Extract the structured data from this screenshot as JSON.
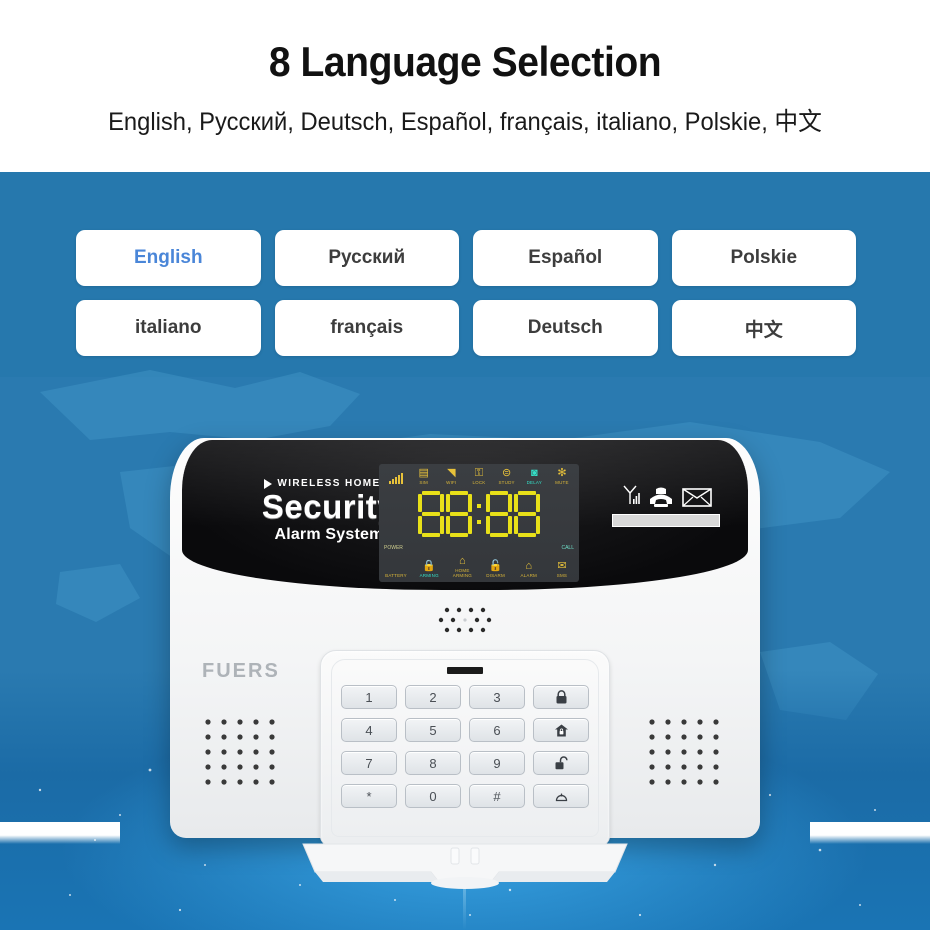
{
  "header": {
    "title": "8 Language Selection",
    "subtitle": "English, Русский, Deutsch, Español, français, italiano, Polskie, 中文"
  },
  "language_buttons": [
    {
      "label": "English",
      "name": "lang-button-english",
      "selected": true
    },
    {
      "label": "Русский",
      "name": "lang-button-russian",
      "selected": false
    },
    {
      "label": "Español",
      "name": "lang-button-spanish",
      "selected": false
    },
    {
      "label": "Polskie",
      "name": "lang-button-polish",
      "selected": false
    },
    {
      "label": "italiano",
      "name": "lang-button-italian",
      "selected": false
    },
    {
      "label": "français",
      "name": "lang-button-french",
      "selected": false
    },
    {
      "label": "Deutsch",
      "name": "lang-button-german",
      "selected": false
    },
    {
      "label": "中文",
      "name": "lang-button-chinese",
      "selected": false
    }
  ],
  "device": {
    "brand_top": "WIRELESS HOME",
    "brand_main": "Security",
    "brand_sub": "Alarm System",
    "logo": "FUERS",
    "lcd": {
      "display_value": "88:88",
      "top_icons": [
        {
          "label": "",
          "icon": "signal-bars-icon",
          "active": false
        },
        {
          "label": "SIM",
          "icon": "sim-card-icon",
          "active": false
        },
        {
          "label": "WIFI",
          "icon": "wifi-icon",
          "active": false
        },
        {
          "label": "LOCK",
          "icon": "key-lock-icon",
          "active": false
        },
        {
          "label": "STUDY",
          "icon": "study-icon",
          "active": false
        },
        {
          "label": "DELAY",
          "icon": "delay-icon",
          "active": true
        },
        {
          "label": "MUTE",
          "icon": "mute-icon",
          "active": false
        }
      ],
      "bottom_icons": [
        {
          "label": "POWER",
          "icon": "power-icon",
          "active": false
        },
        {
          "label": "BATTERY",
          "icon": "battery-icon",
          "active": false
        },
        {
          "label": "ARMING",
          "icon": "lock-closed-icon",
          "active": true
        },
        {
          "label": "HOME ARMING",
          "icon": "home-lock-icon",
          "active": false
        },
        {
          "label": "DISARM",
          "icon": "lock-open-icon",
          "active": false
        },
        {
          "label": "ALARM",
          "icon": "bell-icon",
          "active": false
        },
        {
          "label": "CALL",
          "icon": "phone-call-icon",
          "active": true
        },
        {
          "label": "SMS",
          "icon": "sms-icon",
          "active": false
        }
      ]
    },
    "panel_right_icons": [
      "antenna-signal-icon",
      "telephone-icon",
      "envelope-icon"
    ],
    "keypad": [
      {
        "label": "1",
        "name": "key-1",
        "icon": ""
      },
      {
        "label": "2",
        "name": "key-2",
        "icon": ""
      },
      {
        "label": "3",
        "name": "key-3",
        "icon": ""
      },
      {
        "label": "",
        "name": "key-arm",
        "icon": "lock-closed-icon"
      },
      {
        "label": "4",
        "name": "key-4",
        "icon": ""
      },
      {
        "label": "5",
        "name": "key-5",
        "icon": ""
      },
      {
        "label": "6",
        "name": "key-6",
        "icon": ""
      },
      {
        "label": "",
        "name": "key-home-arm",
        "icon": "home-lock-icon"
      },
      {
        "label": "7",
        "name": "key-7",
        "icon": ""
      },
      {
        "label": "8",
        "name": "key-8",
        "icon": ""
      },
      {
        "label": "9",
        "name": "key-9",
        "icon": ""
      },
      {
        "label": "",
        "name": "key-disarm",
        "icon": "lock-open-icon"
      },
      {
        "label": "*",
        "name": "key-star",
        "icon": ""
      },
      {
        "label": "0",
        "name": "key-0",
        "icon": ""
      },
      {
        "label": "#",
        "name": "key-hash",
        "icon": ""
      },
      {
        "label": "",
        "name": "key-sos-bell",
        "icon": "bell-icon"
      }
    ]
  },
  "colors": {
    "stage_blue": "#2678ad",
    "accent_blue": "#4a86d8",
    "lcd_yellow": "#e8e019",
    "lcd_active": "#34e0c8",
    "button_white": "#ffffff",
    "title_black": "#111111"
  }
}
